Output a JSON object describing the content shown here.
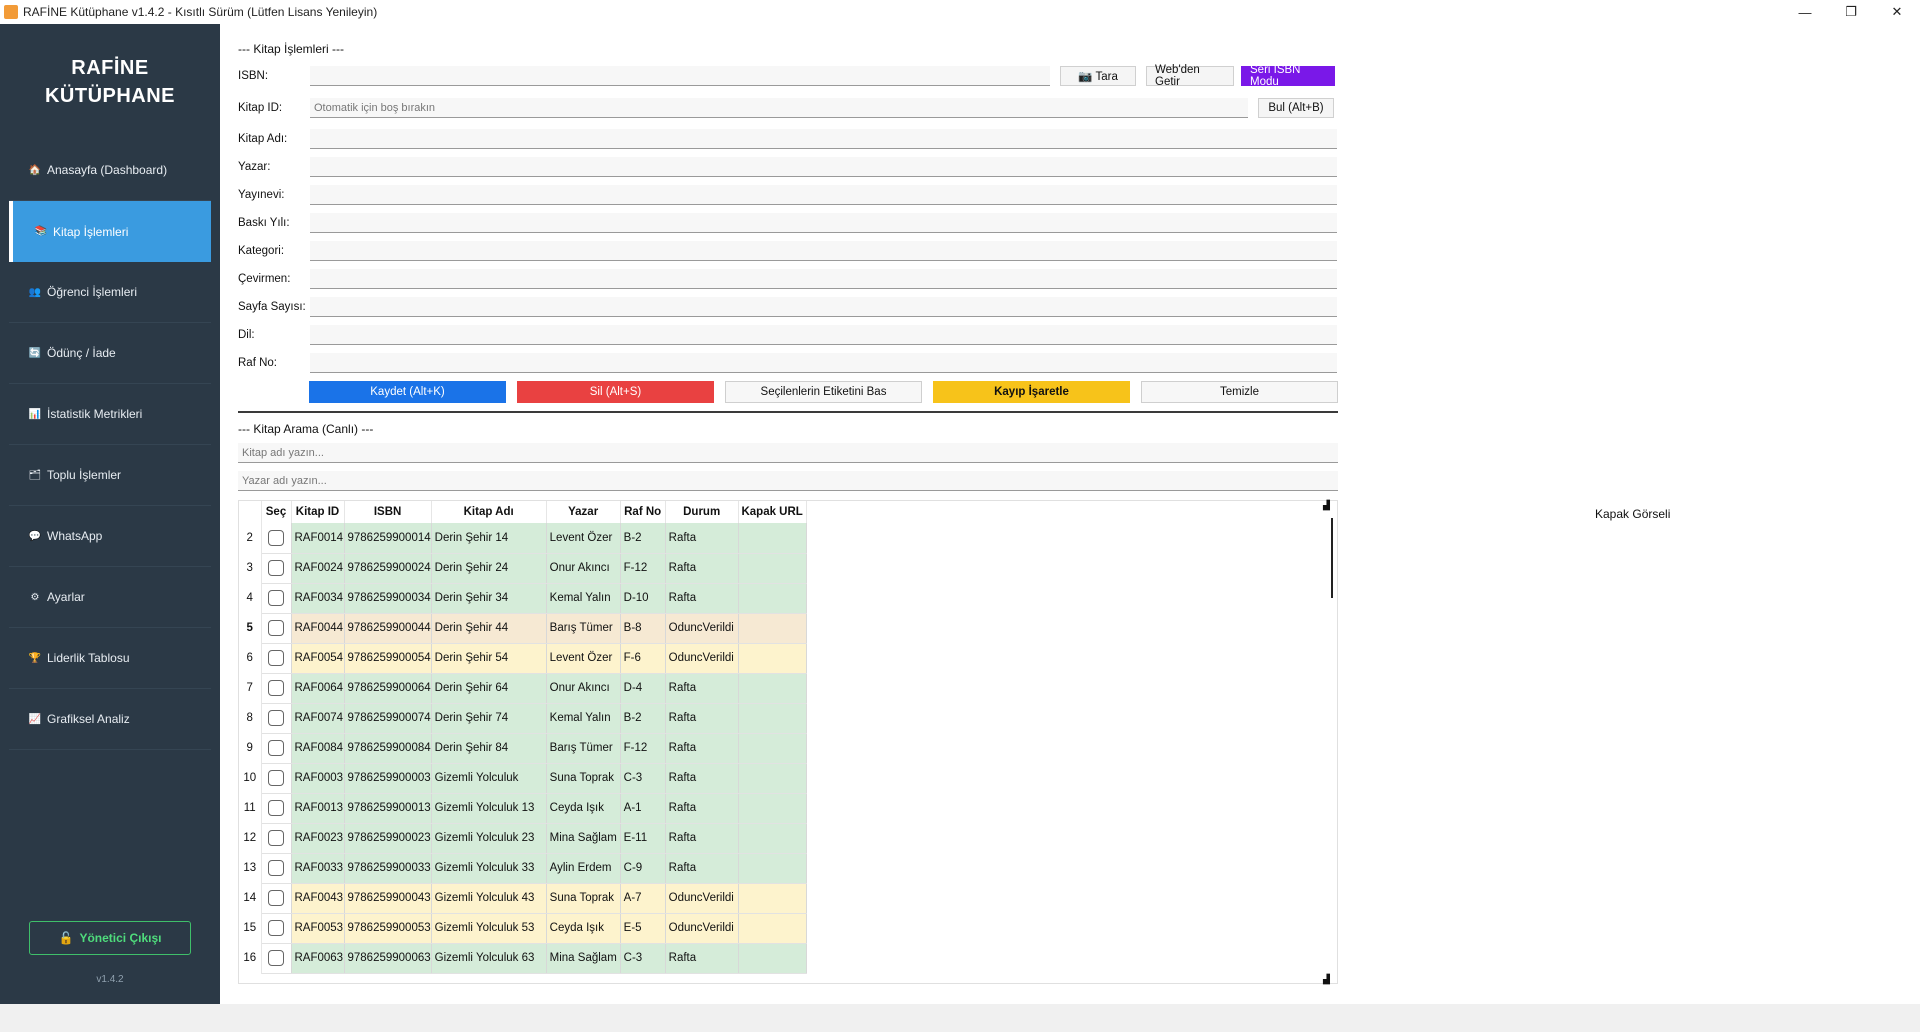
{
  "window": {
    "title": "RAFİNE Kütüphane v1.4.2 - Kısıtlı Sürüm (Lütfen Lisans Yenileyin)",
    "controls": [
      "—",
      "❐",
      "✕"
    ]
  },
  "sidebar": {
    "brand_line1": "RAFİNE",
    "brand_line2": "KÜTÜPHANE",
    "items": [
      {
        "label": "Anasayfa (Dashboard)",
        "icon": "home-icon",
        "glyph": "🏠"
      },
      {
        "label": "Kitap İşlemleri",
        "icon": "books-icon",
        "glyph": "📚"
      },
      {
        "label": "Öğrenci İşlemleri",
        "icon": "students-icon",
        "glyph": "👥"
      },
      {
        "label": "Ödünç / İade",
        "icon": "exchange-icon",
        "glyph": "🔄"
      },
      {
        "label": "İstatistik Metrikleri",
        "icon": "stats-icon",
        "glyph": "📊"
      },
      {
        "label": "Toplu İşlemler",
        "icon": "batch-icon",
        "glyph": "🗂"
      },
      {
        "label": "WhatsApp",
        "icon": "chat-icon",
        "glyph": "💬"
      },
      {
        "label": "Ayarlar",
        "icon": "gear-icon",
        "glyph": "⚙"
      },
      {
        "label": "Liderlik Tablosu",
        "icon": "trophy-icon",
        "glyph": "🏆"
      },
      {
        "label": "Grafiksel Analiz",
        "icon": "chart-icon",
        "glyph": "📈"
      }
    ],
    "logout_label": "Yönetici Çıkışı",
    "logout_glyph": "🔓",
    "version": "v1.4.2"
  },
  "form": {
    "section_title": "--- Kitap İşlemleri ---",
    "isbn_label": "ISBN:",
    "isbn_value": "",
    "scan_label": "📷 Tara",
    "web_label": "Web'den Getir",
    "serial_label": "Seri ISBN Modu",
    "id_label": "Kitap ID:",
    "id_placeholder": "Otomatik için boş bırakın",
    "find_label": "Bul (Alt+B)",
    "fields": [
      {
        "label": "Kitap Adı:",
        "value": ""
      },
      {
        "label": "Yazar:",
        "value": ""
      },
      {
        "label": "Yayınevi:",
        "value": ""
      },
      {
        "label": "Baskı Yılı:",
        "value": ""
      },
      {
        "label": "Kategori:",
        "value": ""
      },
      {
        "label": "Çevirmen:",
        "value": ""
      },
      {
        "label": "Sayfa Sayısı:",
        "value": ""
      },
      {
        "label": "Dil:",
        "value": ""
      },
      {
        "label": "Raf No:",
        "value": ""
      }
    ]
  },
  "actions": {
    "save": "Kaydet (Alt+K)",
    "delete": "Sil (Alt+S)",
    "print_labels": "Seçilenlerin Etiketini Bas",
    "mark_lost": "Kayıp İşaretle",
    "clear": "Temizle"
  },
  "colors": {
    "save": "#1a73e8",
    "delete": "#e94141",
    "mark_lost": "#f7c31a",
    "serial": "#7a18e8"
  },
  "search": {
    "section_title": "--- Kitap Arama (Canlı) ---",
    "title_placeholder": "Kitap adı yazın...",
    "author_placeholder": "Yazar adı yazın..."
  },
  "table": {
    "headers": [
      "Seç",
      "Kitap ID",
      "ISBN",
      "Kitap Adı",
      "Yazar",
      "Raf No",
      "Durum",
      "Kapak URL"
    ],
    "rows": [
      {
        "idx": "2",
        "id": "RAF0014",
        "isbn": "9786259900014",
        "title": "Derin Şehir 14",
        "author": "Levent Özer",
        "shelf": "B-2",
        "status": "Rafta",
        "cover": "",
        "tone": "green"
      },
      {
        "idx": "3",
        "id": "RAF0024",
        "isbn": "9786259900024",
        "title": "Derin Şehir 24",
        "author": "Onur Akıncı",
        "shelf": "F-12",
        "status": "Rafta",
        "cover": "",
        "tone": "green"
      },
      {
        "idx": "4",
        "id": "RAF0034",
        "isbn": "9786259900034",
        "title": "Derin Şehir 34",
        "author": "Kemal Yalın",
        "shelf": "D-10",
        "status": "Rafta",
        "cover": "",
        "tone": "green"
      },
      {
        "idx": "5",
        "id": "RAF0044",
        "isbn": "9786259900044",
        "title": "Derin Şehir 44",
        "author": "Barış Tümer",
        "shelf": "B-8",
        "status": "OduncVerildi",
        "cover": "",
        "tone": "sel"
      },
      {
        "idx": "6",
        "id": "RAF0054",
        "isbn": "9786259900054",
        "title": "Derin Şehir 54",
        "author": "Levent Özer",
        "shelf": "F-6",
        "status": "OduncVerildi",
        "cover": "",
        "tone": "yellow"
      },
      {
        "idx": "7",
        "id": "RAF0064",
        "isbn": "9786259900064",
        "title": "Derin Şehir 64",
        "author": "Onur Akıncı",
        "shelf": "D-4",
        "status": "Rafta",
        "cover": "",
        "tone": "green"
      },
      {
        "idx": "8",
        "id": "RAF0074",
        "isbn": "9786259900074",
        "title": "Derin Şehir 74",
        "author": "Kemal Yalın",
        "shelf": "B-2",
        "status": "Rafta",
        "cover": "",
        "tone": "green"
      },
      {
        "idx": "9",
        "id": "RAF0084",
        "isbn": "9786259900084",
        "title": "Derin Şehir 84",
        "author": "Barış Tümer",
        "shelf": "F-12",
        "status": "Rafta",
        "cover": "",
        "tone": "green"
      },
      {
        "idx": "10",
        "id": "RAF0003",
        "isbn": "9786259900003",
        "title": "Gizemli Yolculuk",
        "author": "Suna Toprak",
        "shelf": "C-3",
        "status": "Rafta",
        "cover": "",
        "tone": "green"
      },
      {
        "idx": "11",
        "id": "RAF0013",
        "isbn": "9786259900013",
        "title": "Gizemli Yolculuk 13",
        "author": "Ceyda Işık",
        "shelf": "A-1",
        "status": "Rafta",
        "cover": "",
        "tone": "green"
      },
      {
        "idx": "12",
        "id": "RAF0023",
        "isbn": "9786259900023",
        "title": "Gizemli Yolculuk 23",
        "author": "Mina Sağlam",
        "shelf": "E-11",
        "status": "Rafta",
        "cover": "",
        "tone": "green"
      },
      {
        "idx": "13",
        "id": "RAF0033",
        "isbn": "9786259900033",
        "title": "Gizemli Yolculuk 33",
        "author": "Aylin Erdem",
        "shelf": "C-9",
        "status": "Rafta",
        "cover": "",
        "tone": "green"
      },
      {
        "idx": "14",
        "id": "RAF0043",
        "isbn": "9786259900043",
        "title": "Gizemli Yolculuk 43",
        "author": "Suna Toprak",
        "shelf": "A-7",
        "status": "OduncVerildi",
        "cover": "",
        "tone": "yellow"
      },
      {
        "idx": "15",
        "id": "RAF0053",
        "isbn": "9786259900053",
        "title": "Gizemli Yolculuk 53",
        "author": "Ceyda Işık",
        "shelf": "E-5",
        "status": "OduncVerildi",
        "cover": "",
        "tone": "yellow"
      },
      {
        "idx": "16",
        "id": "RAF0063",
        "isbn": "9786259900063",
        "title": "Gizemli Yolculuk 63",
        "author": "Mina Sağlam",
        "shelf": "C-3",
        "status": "Rafta",
        "cover": "",
        "tone": "green"
      }
    ]
  },
  "cover_panel": {
    "label": "Kapak Görseli"
  }
}
